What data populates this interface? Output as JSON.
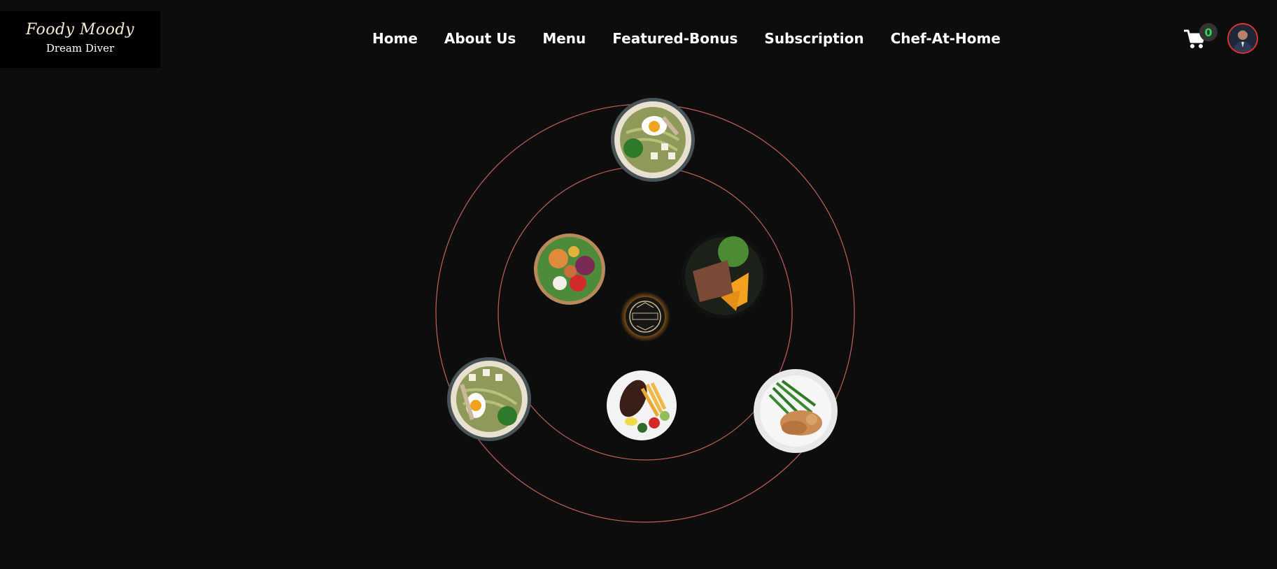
{
  "logo": {
    "title": "Foody Moody",
    "subtitle": "Dream Diver"
  },
  "nav": {
    "home": "Home",
    "about": "About Us",
    "menu": "Menu",
    "featured": "Featured-Bonus",
    "subscription": "Subscription",
    "chef": "Chef-At-Home"
  },
  "cart": {
    "count": "0"
  },
  "colors": {
    "background": "#0d0d0d",
    "orbit": "#c0625a",
    "badge_text": "#2fd35a",
    "avatar_ring": "#e0322e"
  },
  "dishes": [
    "ramen-bowl",
    "salad-bowl",
    "steak-salad",
    "center-emblem",
    "ramen-bowl",
    "steak-fries-plate",
    "green-beans-chicken-plate"
  ]
}
